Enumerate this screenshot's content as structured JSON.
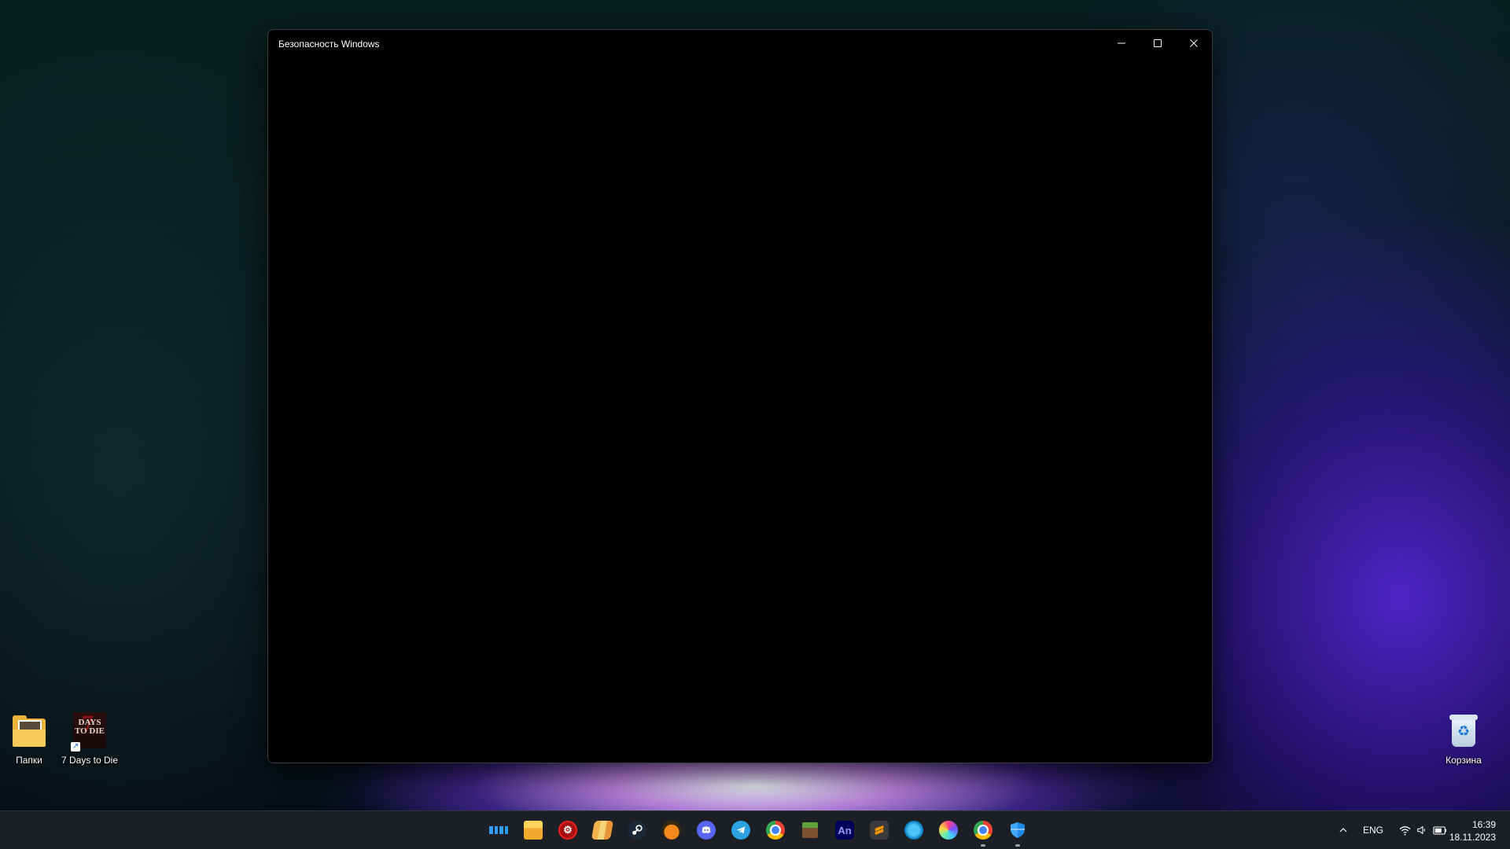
{
  "window": {
    "title": "Безопасность Windows",
    "caption_buttons": [
      "minimize",
      "maximize",
      "close"
    ]
  },
  "desktop": {
    "icons": [
      {
        "label": "Папки",
        "icon": "folder-icon"
      },
      {
        "label": "7 Days to Die",
        "icon": "game-shortcut-icon",
        "art_text": "DAYS TO DIE"
      },
      {
        "label": "Корзина",
        "icon": "recycle-bin-icon"
      }
    ]
  },
  "taskbar": {
    "apps": [
      {
        "name": "start",
        "icon": "windows-start-icon",
        "running": false
      },
      {
        "name": "file-explorer",
        "icon": "folder-icon",
        "running": false
      },
      {
        "name": "red-app",
        "icon": "red-gear-icon",
        "running": false
      },
      {
        "name": "books",
        "icon": "books-icon",
        "running": false
      },
      {
        "name": "steam",
        "icon": "steam-icon",
        "running": false
      },
      {
        "name": "fl-studio",
        "icon": "fruit-icon",
        "running": false
      },
      {
        "name": "discord",
        "icon": "discord-icon",
        "running": false
      },
      {
        "name": "telegram",
        "icon": "telegram-icon",
        "running": false
      },
      {
        "name": "chrome",
        "icon": "chrome-icon",
        "running": false
      },
      {
        "name": "minecraft",
        "icon": "grass-block-icon",
        "running": false
      },
      {
        "name": "animate",
        "icon": "animate-icon",
        "label": "An",
        "running": false
      },
      {
        "name": "sublime-text",
        "icon": "sublime-icon",
        "running": false
      },
      {
        "name": "network-app",
        "icon": "globe-icon",
        "running": false
      },
      {
        "name": "color-app",
        "icon": "color-wheel-icon",
        "running": false
      },
      {
        "name": "chrome-2",
        "icon": "chrome-icon",
        "running": true
      },
      {
        "name": "windows-security",
        "icon": "shield-icon",
        "running": true
      }
    ],
    "tray": {
      "chevron": "chevron-up-icon",
      "language": "ENG",
      "icons": [
        "wifi-icon",
        "volume-icon",
        "battery-icon"
      ],
      "time": "16:39",
      "date": "18.11.2023"
    }
  }
}
